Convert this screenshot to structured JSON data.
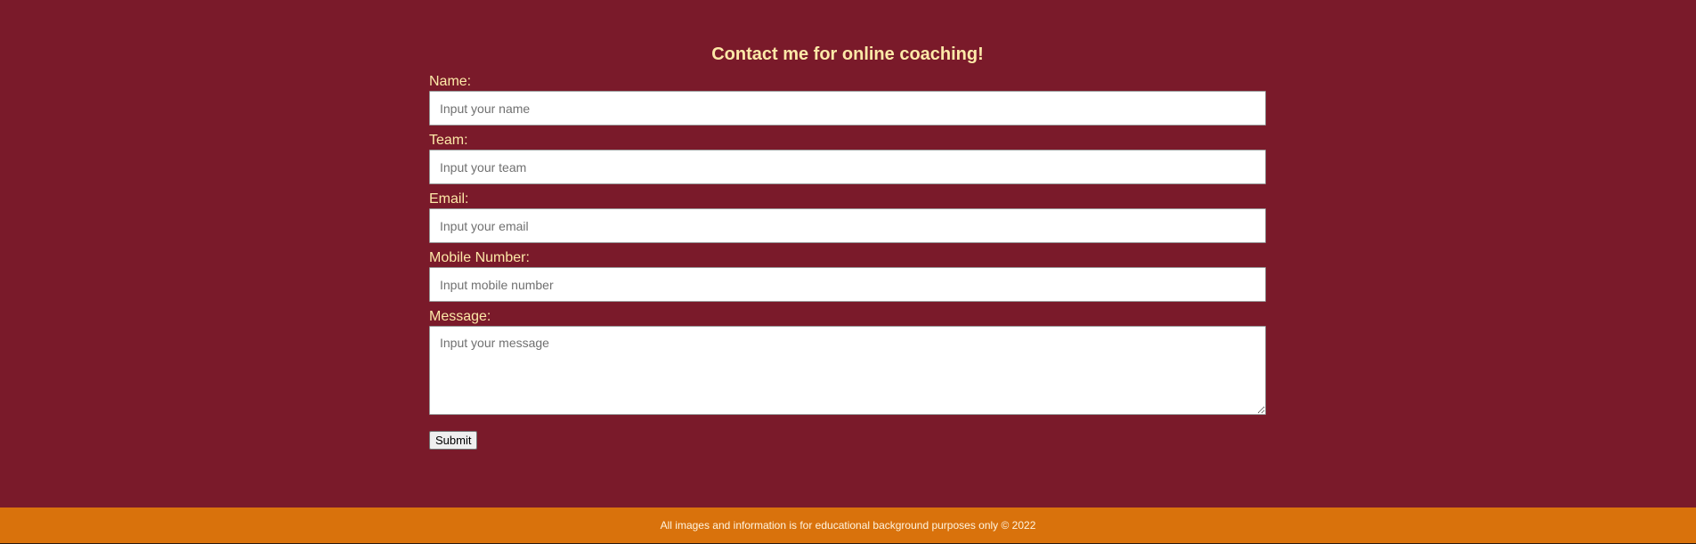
{
  "page": {
    "background_color": "#7a1a2a",
    "accent_text_color": "#fde9a8",
    "footer_color": "#d9720c"
  },
  "form": {
    "title": "Contact me for online coaching!",
    "name": {
      "label": "Name:",
      "value": "",
      "placeholder": "Input your name"
    },
    "team": {
      "label": "Team:",
      "value": "",
      "placeholder": "Input your team"
    },
    "email": {
      "label": "Email:",
      "value": "",
      "placeholder": "Input your email"
    },
    "mobile": {
      "label": "Mobile Number:",
      "value": "",
      "placeholder": "Input mobile number"
    },
    "message": {
      "label": "Message:",
      "value": "",
      "placeholder": "Input your message"
    },
    "submit_label": "Submit"
  },
  "footer": {
    "text": "All images and information is for educational background purposes only © 2022"
  }
}
